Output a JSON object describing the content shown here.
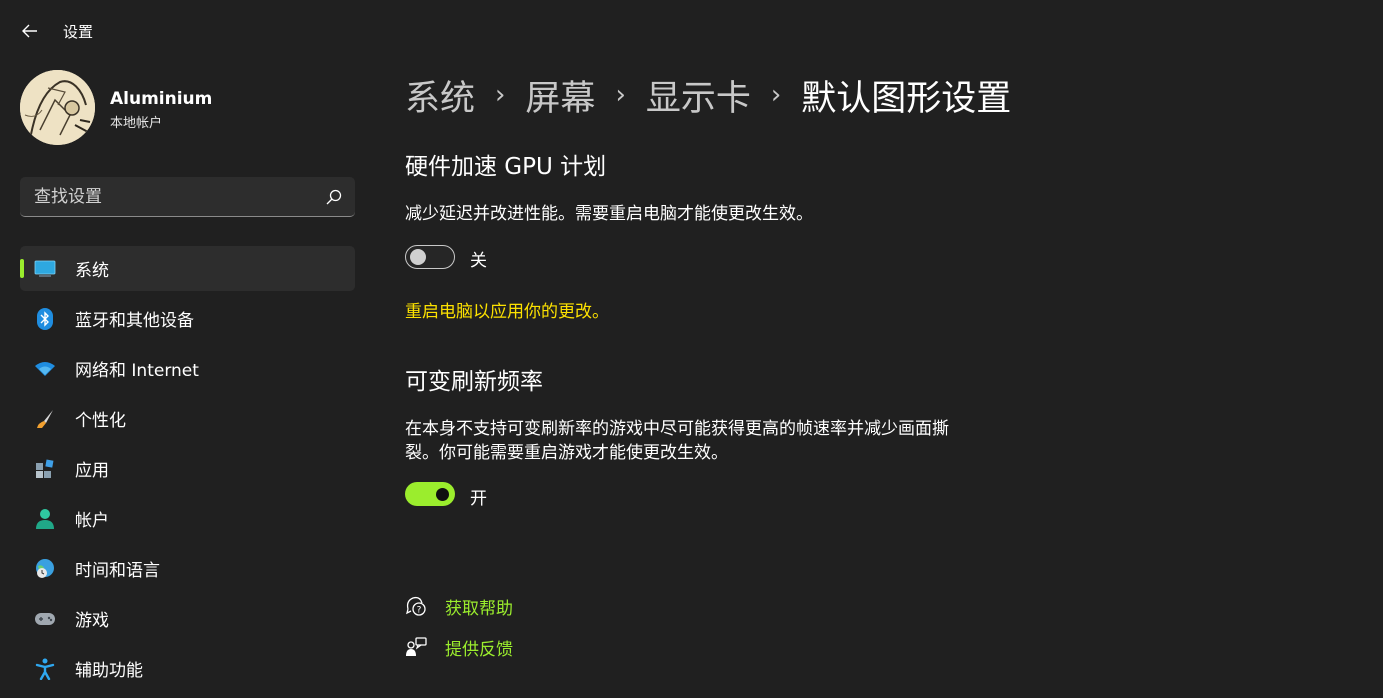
{
  "window": {
    "title": "设置"
  },
  "profile": {
    "name": "Aluminium",
    "account_type": "本地帐户"
  },
  "search": {
    "placeholder": "查找设置"
  },
  "sidebar": {
    "items": [
      {
        "label": "系统",
        "icon": "system-icon",
        "active": true
      },
      {
        "label": "蓝牙和其他设备",
        "icon": "bluetooth-icon"
      },
      {
        "label": "网络和 Internet",
        "icon": "wifi-icon"
      },
      {
        "label": "个性化",
        "icon": "brush-icon"
      },
      {
        "label": "应用",
        "icon": "apps-icon"
      },
      {
        "label": "帐户",
        "icon": "account-icon"
      },
      {
        "label": "时间和语言",
        "icon": "globe-clock-icon"
      },
      {
        "label": "游戏",
        "icon": "gamepad-icon"
      },
      {
        "label": "辅助功能",
        "icon": "accessibility-icon"
      }
    ]
  },
  "breadcrumb": {
    "items": [
      "系统",
      "屏幕",
      "显示卡",
      "默认图形设置"
    ],
    "separator": "›"
  },
  "hags": {
    "title": "硬件加速 GPU 计划",
    "description": "减少延迟并改进性能。需要重启电脑才能使更改生效。",
    "state": "关",
    "enabled": false,
    "restart_notice": "重启电脑以应用你的更改。"
  },
  "vrr": {
    "title": "可变刷新频率",
    "description_line1": "在本身不支持可变刷新率的游戏中尽可能获得更高的帧速率并减少画面撕",
    "description_line2": "裂。你可能需要重启游戏才能使更改生效。",
    "state": "开",
    "enabled": true
  },
  "links": {
    "help": "获取帮助",
    "feedback": "提供反馈"
  },
  "colors": {
    "accent": "#9bed2d",
    "warning": "#fce100",
    "background": "#202020"
  }
}
